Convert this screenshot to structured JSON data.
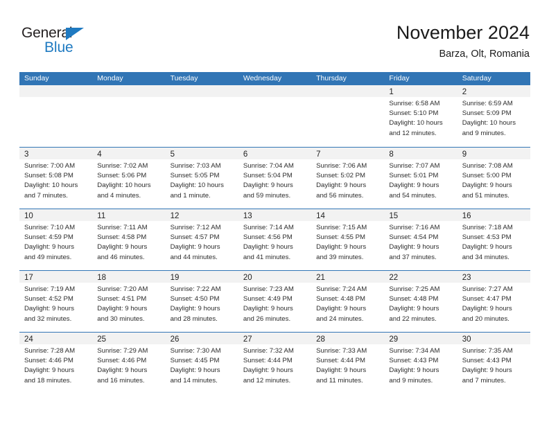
{
  "brand": {
    "name_part1": "General",
    "name_part2": "Blue",
    "accent_color": "#1f7ac1"
  },
  "header": {
    "title": "November 2024",
    "subtitle": "Barza, Olt, Romania"
  },
  "colors": {
    "header_blue": "#3175b5",
    "day_band_gray": "#f2f2f2",
    "text": "#2b2b2b"
  },
  "weekdays": [
    "Sunday",
    "Monday",
    "Tuesday",
    "Wednesday",
    "Thursday",
    "Friday",
    "Saturday"
  ],
  "labels": {
    "sunrise_prefix": "Sunrise:",
    "sunset_prefix": "Sunset:",
    "daylight_prefix": "Daylight:"
  },
  "weeks": [
    [
      {
        "day": "",
        "sunrise": "",
        "sunset": "",
        "daylight_line1": "",
        "daylight_line2": ""
      },
      {
        "day": "",
        "sunrise": "",
        "sunset": "",
        "daylight_line1": "",
        "daylight_line2": ""
      },
      {
        "day": "",
        "sunrise": "",
        "sunset": "",
        "daylight_line1": "",
        "daylight_line2": ""
      },
      {
        "day": "",
        "sunrise": "",
        "sunset": "",
        "daylight_line1": "",
        "daylight_line2": ""
      },
      {
        "day": "",
        "sunrise": "",
        "sunset": "",
        "daylight_line1": "",
        "daylight_line2": ""
      },
      {
        "day": "1",
        "sunrise": "Sunrise: 6:58 AM",
        "sunset": "Sunset: 5:10 PM",
        "daylight_line1": "Daylight: 10 hours",
        "daylight_line2": "and 12 minutes."
      },
      {
        "day": "2",
        "sunrise": "Sunrise: 6:59 AM",
        "sunset": "Sunset: 5:09 PM",
        "daylight_line1": "Daylight: 10 hours",
        "daylight_line2": "and 9 minutes."
      }
    ],
    [
      {
        "day": "3",
        "sunrise": "Sunrise: 7:00 AM",
        "sunset": "Sunset: 5:08 PM",
        "daylight_line1": "Daylight: 10 hours",
        "daylight_line2": "and 7 minutes."
      },
      {
        "day": "4",
        "sunrise": "Sunrise: 7:02 AM",
        "sunset": "Sunset: 5:06 PM",
        "daylight_line1": "Daylight: 10 hours",
        "daylight_line2": "and 4 minutes."
      },
      {
        "day": "5",
        "sunrise": "Sunrise: 7:03 AM",
        "sunset": "Sunset: 5:05 PM",
        "daylight_line1": "Daylight: 10 hours",
        "daylight_line2": "and 1 minute."
      },
      {
        "day": "6",
        "sunrise": "Sunrise: 7:04 AM",
        "sunset": "Sunset: 5:04 PM",
        "daylight_line1": "Daylight: 9 hours",
        "daylight_line2": "and 59 minutes."
      },
      {
        "day": "7",
        "sunrise": "Sunrise: 7:06 AM",
        "sunset": "Sunset: 5:02 PM",
        "daylight_line1": "Daylight: 9 hours",
        "daylight_line2": "and 56 minutes."
      },
      {
        "day": "8",
        "sunrise": "Sunrise: 7:07 AM",
        "sunset": "Sunset: 5:01 PM",
        "daylight_line1": "Daylight: 9 hours",
        "daylight_line2": "and 54 minutes."
      },
      {
        "day": "9",
        "sunrise": "Sunrise: 7:08 AM",
        "sunset": "Sunset: 5:00 PM",
        "daylight_line1": "Daylight: 9 hours",
        "daylight_line2": "and 51 minutes."
      }
    ],
    [
      {
        "day": "10",
        "sunrise": "Sunrise: 7:10 AM",
        "sunset": "Sunset: 4:59 PM",
        "daylight_line1": "Daylight: 9 hours",
        "daylight_line2": "and 49 minutes."
      },
      {
        "day": "11",
        "sunrise": "Sunrise: 7:11 AM",
        "sunset": "Sunset: 4:58 PM",
        "daylight_line1": "Daylight: 9 hours",
        "daylight_line2": "and 46 minutes."
      },
      {
        "day": "12",
        "sunrise": "Sunrise: 7:12 AM",
        "sunset": "Sunset: 4:57 PM",
        "daylight_line1": "Daylight: 9 hours",
        "daylight_line2": "and 44 minutes."
      },
      {
        "day": "13",
        "sunrise": "Sunrise: 7:14 AM",
        "sunset": "Sunset: 4:56 PM",
        "daylight_line1": "Daylight: 9 hours",
        "daylight_line2": "and 41 minutes."
      },
      {
        "day": "14",
        "sunrise": "Sunrise: 7:15 AM",
        "sunset": "Sunset: 4:55 PM",
        "daylight_line1": "Daylight: 9 hours",
        "daylight_line2": "and 39 minutes."
      },
      {
        "day": "15",
        "sunrise": "Sunrise: 7:16 AM",
        "sunset": "Sunset: 4:54 PM",
        "daylight_line1": "Daylight: 9 hours",
        "daylight_line2": "and 37 minutes."
      },
      {
        "day": "16",
        "sunrise": "Sunrise: 7:18 AM",
        "sunset": "Sunset: 4:53 PM",
        "daylight_line1": "Daylight: 9 hours",
        "daylight_line2": "and 34 minutes."
      }
    ],
    [
      {
        "day": "17",
        "sunrise": "Sunrise: 7:19 AM",
        "sunset": "Sunset: 4:52 PM",
        "daylight_line1": "Daylight: 9 hours",
        "daylight_line2": "and 32 minutes."
      },
      {
        "day": "18",
        "sunrise": "Sunrise: 7:20 AM",
        "sunset": "Sunset: 4:51 PM",
        "daylight_line1": "Daylight: 9 hours",
        "daylight_line2": "and 30 minutes."
      },
      {
        "day": "19",
        "sunrise": "Sunrise: 7:22 AM",
        "sunset": "Sunset: 4:50 PM",
        "daylight_line1": "Daylight: 9 hours",
        "daylight_line2": "and 28 minutes."
      },
      {
        "day": "20",
        "sunrise": "Sunrise: 7:23 AM",
        "sunset": "Sunset: 4:49 PM",
        "daylight_line1": "Daylight: 9 hours",
        "daylight_line2": "and 26 minutes."
      },
      {
        "day": "21",
        "sunrise": "Sunrise: 7:24 AM",
        "sunset": "Sunset: 4:48 PM",
        "daylight_line1": "Daylight: 9 hours",
        "daylight_line2": "and 24 minutes."
      },
      {
        "day": "22",
        "sunrise": "Sunrise: 7:25 AM",
        "sunset": "Sunset: 4:48 PM",
        "daylight_line1": "Daylight: 9 hours",
        "daylight_line2": "and 22 minutes."
      },
      {
        "day": "23",
        "sunrise": "Sunrise: 7:27 AM",
        "sunset": "Sunset: 4:47 PM",
        "daylight_line1": "Daylight: 9 hours",
        "daylight_line2": "and 20 minutes."
      }
    ],
    [
      {
        "day": "24",
        "sunrise": "Sunrise: 7:28 AM",
        "sunset": "Sunset: 4:46 PM",
        "daylight_line1": "Daylight: 9 hours",
        "daylight_line2": "and 18 minutes."
      },
      {
        "day": "25",
        "sunrise": "Sunrise: 7:29 AM",
        "sunset": "Sunset: 4:46 PM",
        "daylight_line1": "Daylight: 9 hours",
        "daylight_line2": "and 16 minutes."
      },
      {
        "day": "26",
        "sunrise": "Sunrise: 7:30 AM",
        "sunset": "Sunset: 4:45 PM",
        "daylight_line1": "Daylight: 9 hours",
        "daylight_line2": "and 14 minutes."
      },
      {
        "day": "27",
        "sunrise": "Sunrise: 7:32 AM",
        "sunset": "Sunset: 4:44 PM",
        "daylight_line1": "Daylight: 9 hours",
        "daylight_line2": "and 12 minutes."
      },
      {
        "day": "28",
        "sunrise": "Sunrise: 7:33 AM",
        "sunset": "Sunset: 4:44 PM",
        "daylight_line1": "Daylight: 9 hours",
        "daylight_line2": "and 11 minutes."
      },
      {
        "day": "29",
        "sunrise": "Sunrise: 7:34 AM",
        "sunset": "Sunset: 4:43 PM",
        "daylight_line1": "Daylight: 9 hours",
        "daylight_line2": "and 9 minutes."
      },
      {
        "day": "30",
        "sunrise": "Sunrise: 7:35 AM",
        "sunset": "Sunset: 4:43 PM",
        "daylight_line1": "Daylight: 9 hours",
        "daylight_line2": "and 7 minutes."
      }
    ]
  ]
}
